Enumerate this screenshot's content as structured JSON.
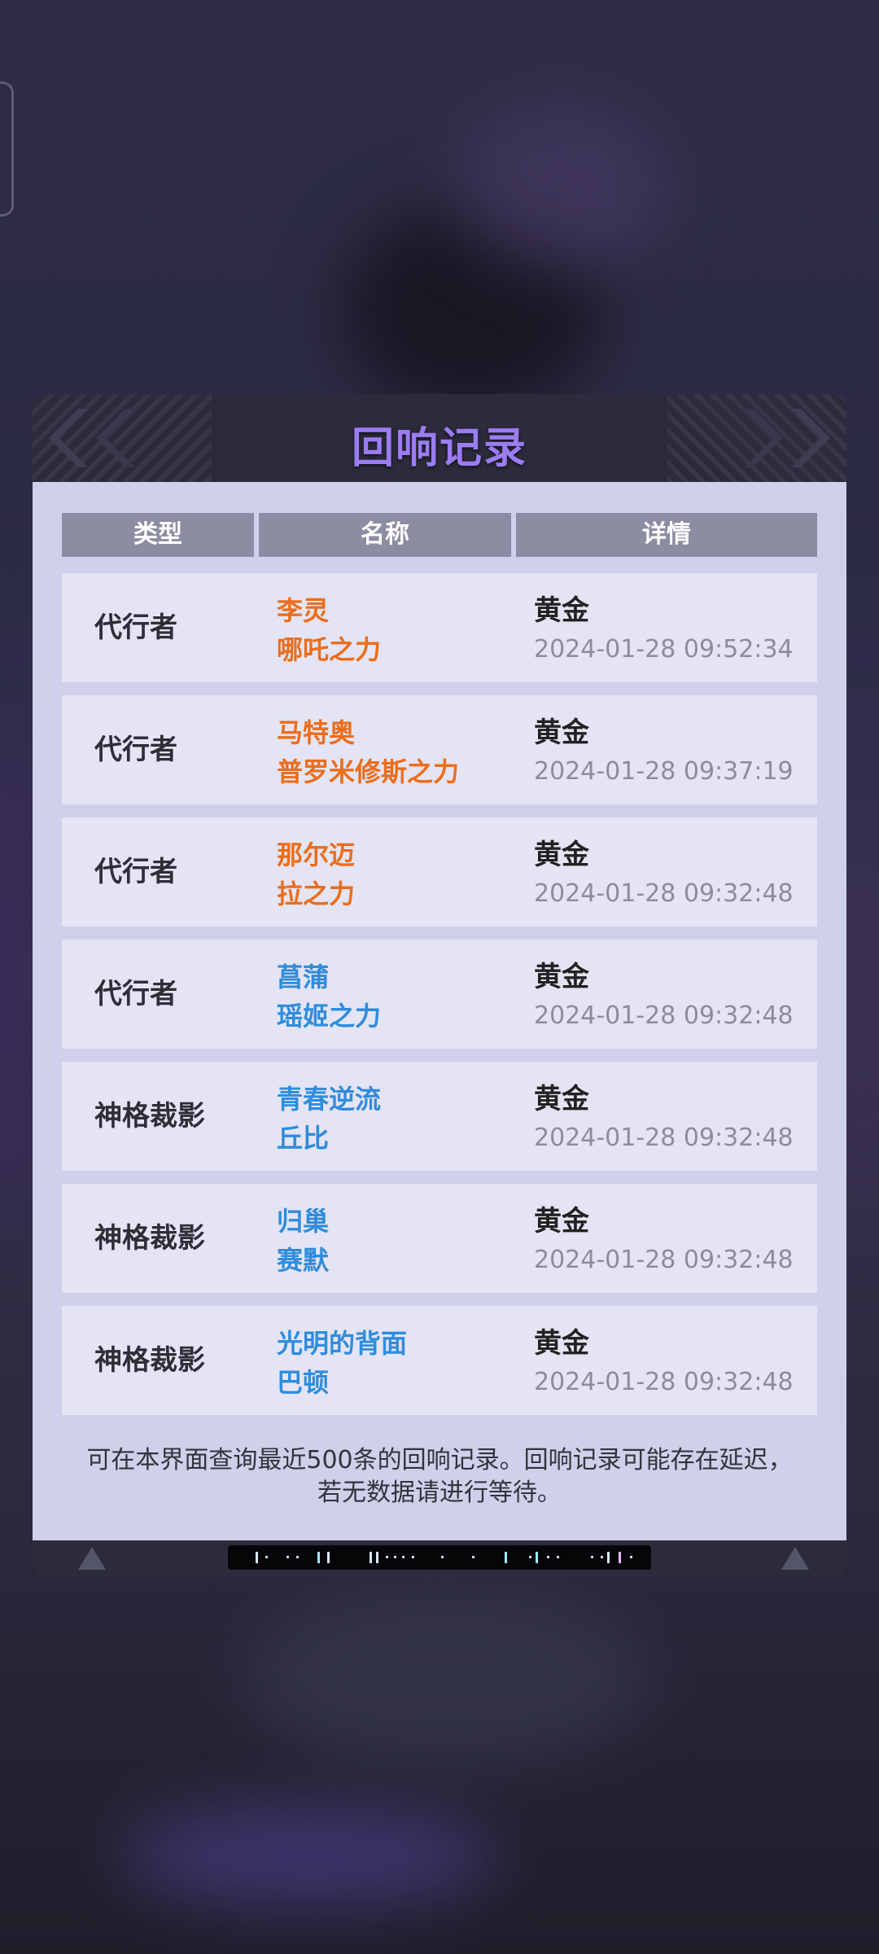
{
  "dialog": {
    "title": "回响记录",
    "columns": [
      "类型",
      "名称",
      "详情"
    ],
    "records": [
      {
        "type": "代行者",
        "name_line1": "李灵",
        "name_line2": "哪吒之力",
        "name_color": "orange",
        "rarity": "黄金",
        "time": "2024-01-28 09:52:34"
      },
      {
        "type": "代行者",
        "name_line1": "马特奥",
        "name_line2": "普罗米修斯之力",
        "name_color": "orange",
        "rarity": "黄金",
        "time": "2024-01-28 09:37:19"
      },
      {
        "type": "代行者",
        "name_line1": "那尔迈",
        "name_line2": "拉之力",
        "name_color": "orange",
        "rarity": "黄金",
        "time": "2024-01-28 09:32:48"
      },
      {
        "type": "代行者",
        "name_line1": "菖蒲",
        "name_line2": "瑶姬之力",
        "name_color": "blue",
        "rarity": "黄金",
        "time": "2024-01-28 09:32:48"
      },
      {
        "type": "神格裁影",
        "name_line1": "青春逆流",
        "name_line2": "丘比",
        "name_color": "blue",
        "rarity": "黄金",
        "time": "2024-01-28 09:32:48"
      },
      {
        "type": "神格裁影",
        "name_line1": "归巢",
        "name_line2": "赛默",
        "name_color": "blue",
        "rarity": "黄金",
        "time": "2024-01-28 09:32:48"
      },
      {
        "type": "神格裁影",
        "name_line1": "光明的背面",
        "name_line2": "巴顿",
        "name_color": "blue",
        "rarity": "黄金",
        "time": "2024-01-28 09:32:48"
      }
    ],
    "notice": "可在本界面查询最近500条的回响记录。回响记录可能存在延迟，若无数据请进行等待。"
  },
  "colors": {
    "title": "#9b7cf3",
    "name_orange": "#ec6d1a",
    "name_blue": "#2f8cdc",
    "panel_bg": "#cfd0ea",
    "row_bg": "#e4e4f4",
    "header_bg": "#2c2b3c"
  },
  "icons": [
    "chevron-left-icon",
    "chevron-right-icon",
    "warning-icon",
    "scan-bar-decoration"
  ]
}
